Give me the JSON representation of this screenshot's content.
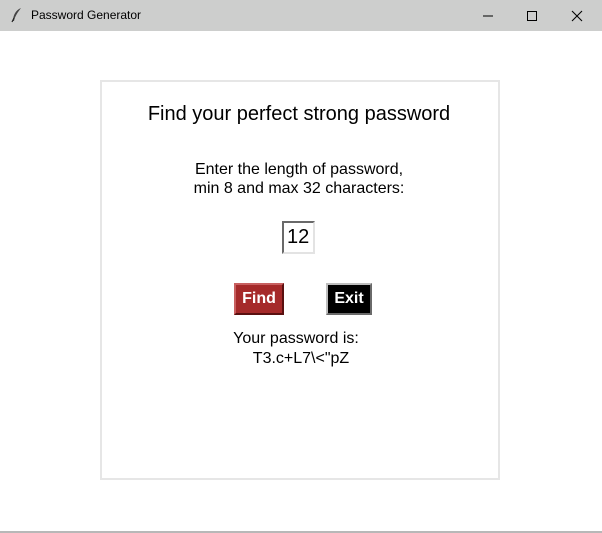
{
  "window": {
    "title": "Password Generator",
    "icon": "feather-icon",
    "titlebar_color": "#cdcecd"
  },
  "main": {
    "heading": "Find your perfect strong password",
    "prompt_line1": "Enter the length of password,",
    "prompt_line2": "min 8 and max 32 characters:",
    "length_value": "12",
    "find_label": "Find",
    "exit_label": "Exit",
    "result_label": "Your password is:",
    "result_value": "T3.c+L7\\<\"pZ"
  },
  "colors": {
    "find_button": "#a52a2a",
    "exit_button": "#000000"
  }
}
